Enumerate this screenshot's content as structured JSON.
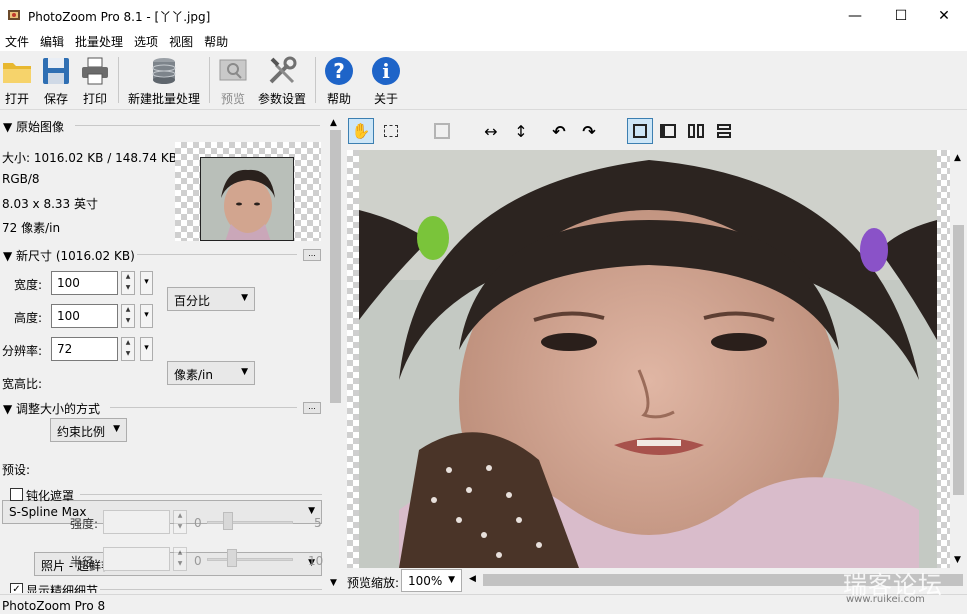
{
  "window": {
    "title": "PhotoZoom Pro 8.1 - [丫丫.jpg]",
    "minimize": "—",
    "maximize": "☐",
    "close": "✕"
  },
  "menu": [
    "文件",
    "编辑",
    "批量处理",
    "选项",
    "视图",
    "帮助"
  ],
  "toolbar": {
    "open": "打开",
    "save": "保存",
    "print": "打印",
    "batch": "新建批量处理",
    "preview": "预览",
    "settings": "参数设置",
    "help": "帮助",
    "about": "关于"
  },
  "original": {
    "header": "▼ 原始图像",
    "size": "大小: 1016.02 KB / 148.74 KB",
    "mode": "RGB/8",
    "dimensions": "8.03 x 8.33 英寸",
    "resolution": "72 像素/in"
  },
  "newsize": {
    "header": "▼ 新尺寸 (1016.02 KB)",
    "width_label": "宽度:",
    "width_value": "100",
    "height_label": "高度:",
    "height_value": "100",
    "res_label": "分辨率:",
    "res_value": "72",
    "unit": "百分比",
    "res_unit": "像素/in",
    "aspect_label": "宽高比:",
    "aspect_value": "约束比例",
    "dots": "..."
  },
  "resize": {
    "header": "▼ 调整大小的方式",
    "method": "S-Spline Max",
    "preset_label": "预设:",
    "preset_value": "照片 - 超鲜艳",
    "dots": "..."
  },
  "unsharp": {
    "label": "钝化遮罩",
    "strength_label": "强度:",
    "strength_min": "0",
    "strength_max": "5",
    "radius_label": "半径:",
    "radius_min": "0",
    "radius_max": "10"
  },
  "detail": {
    "label": "显示精细细节",
    "checked": "✓"
  },
  "preview": {
    "zoom_label": "预览缩放:",
    "zoom_value": "100%"
  },
  "status": "PhotoZoom Pro 8",
  "watermark": "瑞客论坛",
  "watermark_url": "www.ruikei.com",
  "colors": {
    "accent": "#3c7fb1",
    "help_icon": "#1e64c8",
    "hair_tie_green": "#7ac43a",
    "hair_tie_purple": "#8a52c8"
  }
}
